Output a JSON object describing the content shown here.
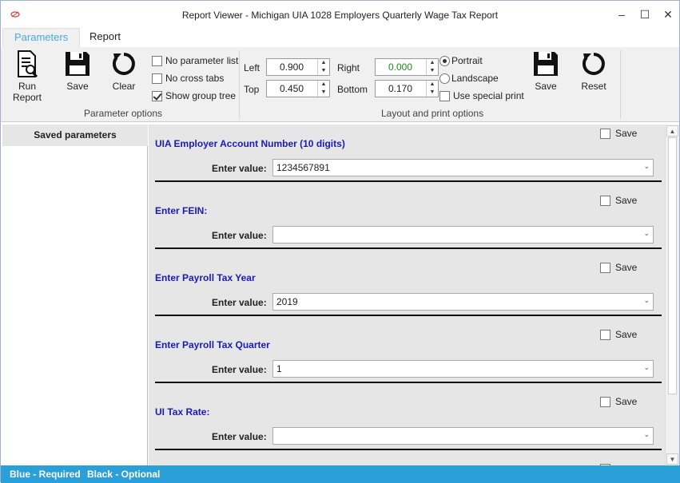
{
  "window": {
    "title": "Report Viewer - Michigan UIA 1028 Employers Quarterly Wage Tax Report",
    "minimize": "–",
    "maximize": "☐",
    "close": "✕"
  },
  "tabs": [
    {
      "label": "Parameters",
      "active": true
    },
    {
      "label": "Report",
      "active": false
    }
  ],
  "ribbon": {
    "run_report_label": "Run Report",
    "save_label": "Save",
    "clear_label": "Clear",
    "options": [
      {
        "label": "No parameter list",
        "checked": false
      },
      {
        "label": "No cross tabs",
        "checked": false
      },
      {
        "label": "Show group tree",
        "checked": true
      }
    ],
    "parameter_group_caption": "Parameter options",
    "margins": {
      "left_label": "Left",
      "left_value": "0.900",
      "top_label": "Top",
      "top_value": "0.450",
      "right_label": "Right",
      "right_value": "0.000",
      "bottom_label": "Bottom",
      "bottom_value": "0.170"
    },
    "orientation": [
      {
        "label": "Portrait",
        "selected": true
      },
      {
        "label": "Landscape",
        "selected": false
      }
    ],
    "special_print": {
      "label": "Use special print",
      "checked": false
    },
    "layout_save_label": "Save",
    "reset_label": "Reset",
    "layout_group_caption": "Layout and print options"
  },
  "saved_parameters": {
    "header": "Saved parameters",
    "items": []
  },
  "parameters": [
    {
      "name": "UIA Employer Account Number (10 digits)",
      "value": "1234567891",
      "save_label": "Save",
      "enter_label": "Enter value:",
      "required": true
    },
    {
      "name": "Enter FEIN:",
      "value": "",
      "save_label": "Save",
      "enter_label": "Enter value:",
      "required": true
    },
    {
      "name": "Enter Payroll Tax Year",
      "value": "2019",
      "save_label": "Save",
      "enter_label": "Enter value:",
      "required": true
    },
    {
      "name": "Enter Payroll Tax Quarter",
      "value": "1",
      "save_label": "Save",
      "enter_label": "Enter value:",
      "required": true
    },
    {
      "name": "UI Tax Rate:",
      "value": "",
      "save_label": "Save",
      "enter_label": "Enter value:",
      "required": true
    }
  ],
  "status": {
    "required_text": "Blue - Required",
    "optional_text": "Black - Optional"
  },
  "colors": {
    "accent": "#2a9fd8",
    "required_text": "#1b1bb5",
    "right_margin_value": "#1a8a1a"
  }
}
